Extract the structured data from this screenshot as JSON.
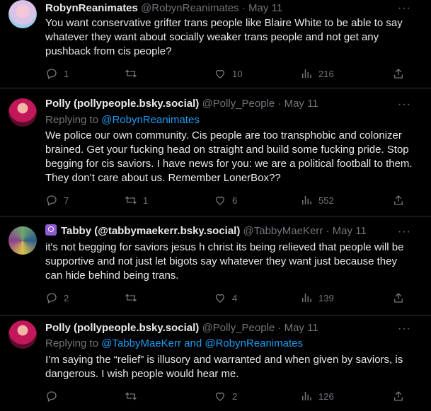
{
  "tweets": [
    {
      "name": "RobynReanimates",
      "handle": "@RobynReanimates",
      "date": "May 11",
      "reply_prefix": "",
      "reply_to": "",
      "text": "You want conservative grifter trans people like Blaire White to be able to say whatever they want about socially weaker trans people and not get any pushback from cis people?",
      "replies": "1",
      "retweets": "",
      "likes": "10",
      "views": "216"
    },
    {
      "name": "Polly (pollypeople.bsky.social)",
      "handle": "@Polly_People",
      "date": "May 11",
      "reply_prefix": "Replying to ",
      "reply_to": "@RobynReanimates",
      "text": "We police our own community. Cis people are too transphobic and colonizer brained. Get your fucking head on straight and build some fucking pride. Stop begging for cis saviors. I have news for you: we are a political football to them. They don’t care about us. Remember LonerBox??",
      "replies": "7",
      "retweets": "1",
      "likes": "6",
      "views": "552"
    },
    {
      "name": "Tabby (@tabbymaekerr.bsky.social)",
      "handle": "@TabbyMaeKerr",
      "date": "May 11",
      "reply_prefix": "",
      "reply_to": "",
      "text": "it's not begging for saviors jesus h christ its being relieved that people will be supportive and not just let bigots say whatever they want just because they can hide behind being trans.",
      "replies": "2",
      "retweets": "",
      "likes": "4",
      "views": "139"
    },
    {
      "name": "Polly (pollypeople.bsky.social)",
      "handle": "@Polly_People",
      "date": "May 11",
      "reply_prefix": "Replying to ",
      "reply_to": "@TabbyMaeKerr and @RobynReanimates",
      "text": "I’m saying the “relief” is illusory and warranted and when given by saviors, is dangerous. I wish people would hear me.",
      "replies": "",
      "retweets": "",
      "likes": "2",
      "views": "126"
    }
  ],
  "separator": "·",
  "colors": {
    "background": "#000000",
    "text": "#e7e9ea",
    "muted": "#71767b",
    "link": "#1d9bf0"
  },
  "icons": [
    "reply-icon",
    "retweet-icon",
    "like-icon",
    "views-icon",
    "share-icon",
    "more-icon"
  ]
}
